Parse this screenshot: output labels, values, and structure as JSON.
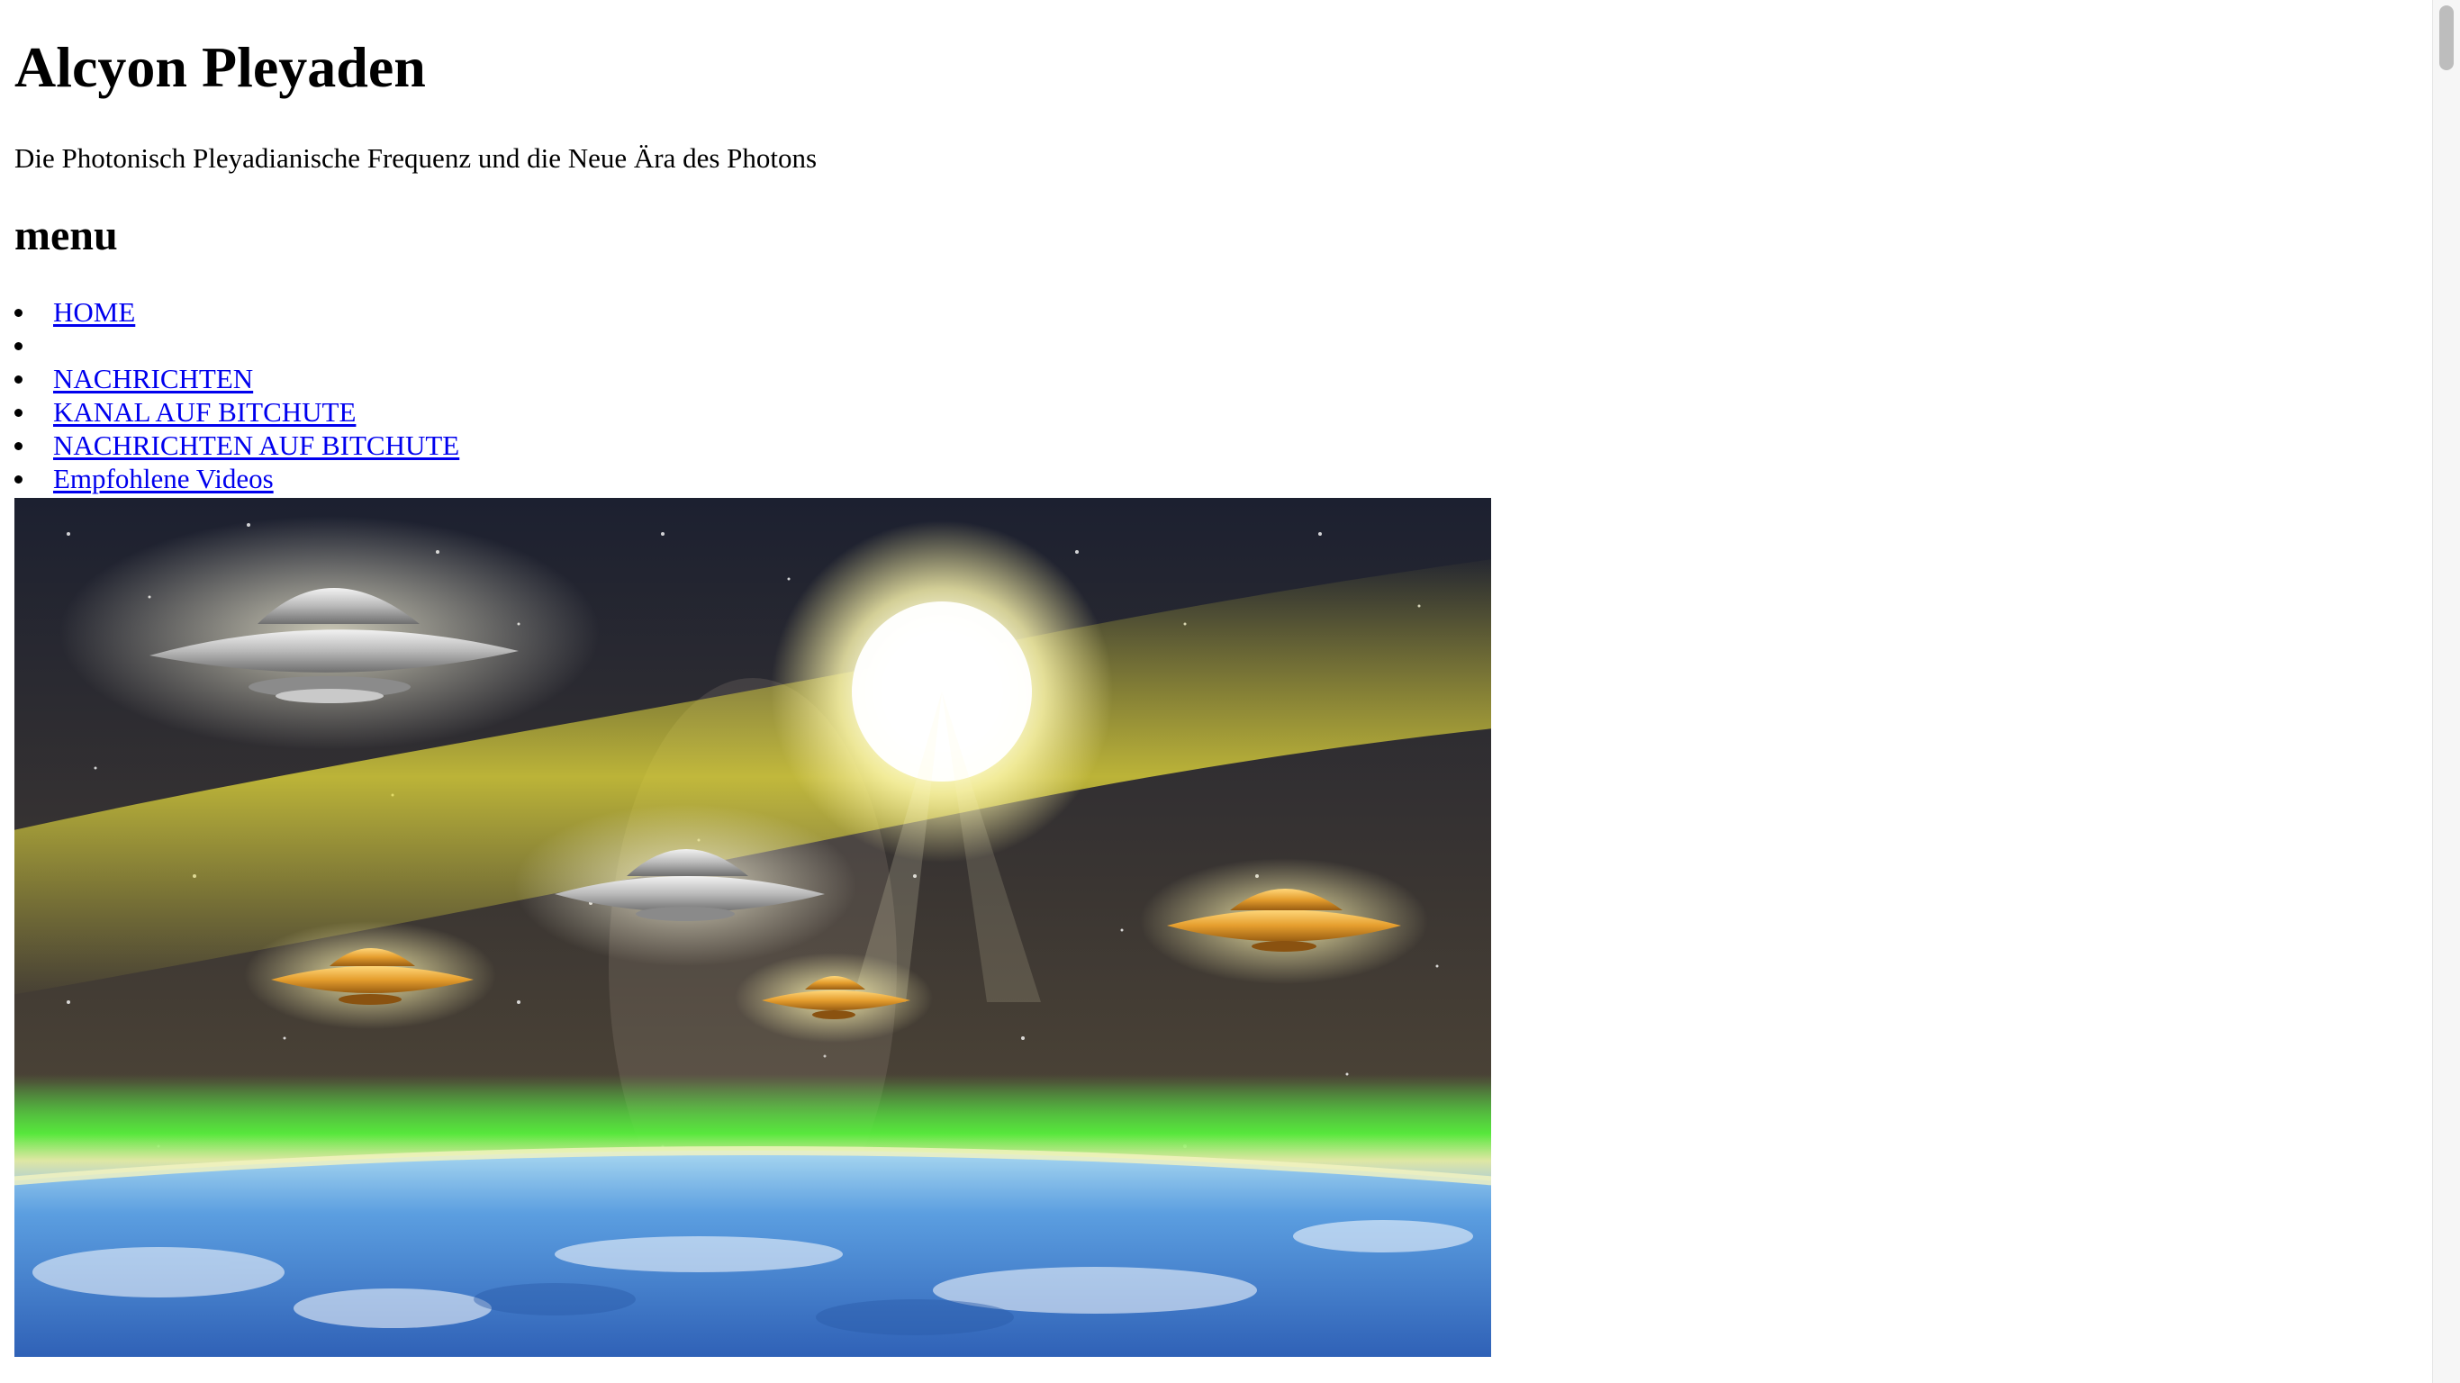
{
  "header": {
    "title": "Alcyon Pleyaden",
    "tagline": "Die Photonisch Pleyadianische Frequenz und die Neue Ära des Photons"
  },
  "menu": {
    "heading": "menu",
    "items": [
      {
        "label": "HOME"
      },
      {
        "label": ""
      },
      {
        "label": "NACHRICHTEN"
      },
      {
        "label": "KANAL AUF BITCHUTE"
      },
      {
        "label": "NACHRICHTEN AUF BITCHUTE"
      },
      {
        "label": "Empfohlene Videos"
      }
    ]
  },
  "colors": {
    "link": "#0000ee",
    "background": "#ffffff",
    "text": "#000000"
  }
}
